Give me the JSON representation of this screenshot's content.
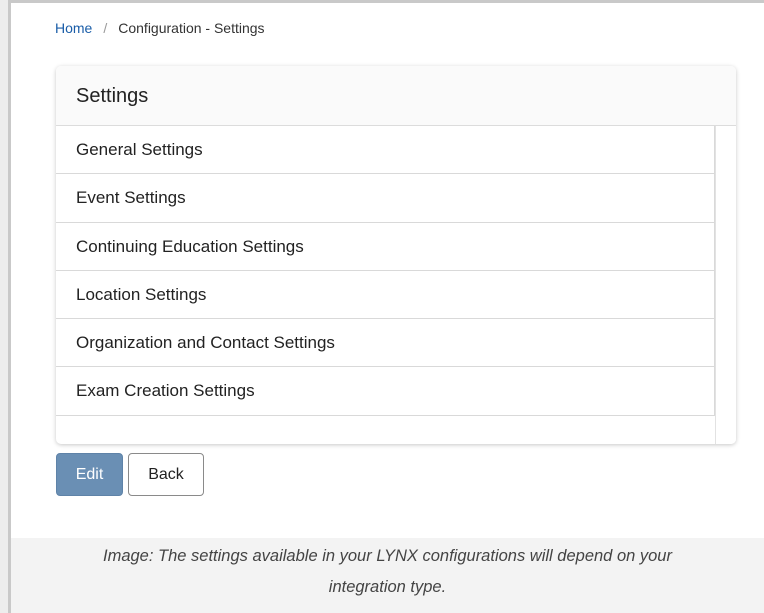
{
  "breadcrumb": {
    "home": "Home",
    "separator": "/",
    "current": "Configuration - Settings"
  },
  "card": {
    "title": "Settings",
    "items": [
      "General Settings",
      "Event Settings",
      "Continuing Education Settings",
      "Location Settings",
      "Organization and Contact Settings",
      "Exam Creation Settings"
    ]
  },
  "actions": {
    "edit_label": "Edit",
    "back_label": "Back"
  },
  "caption": {
    "line1": "Image: The settings available in your LYNX configurations will depend on your",
    "line2": "integration type."
  },
  "colors": {
    "link": "#1a5da8",
    "edit_button": "#6a8fb4"
  }
}
